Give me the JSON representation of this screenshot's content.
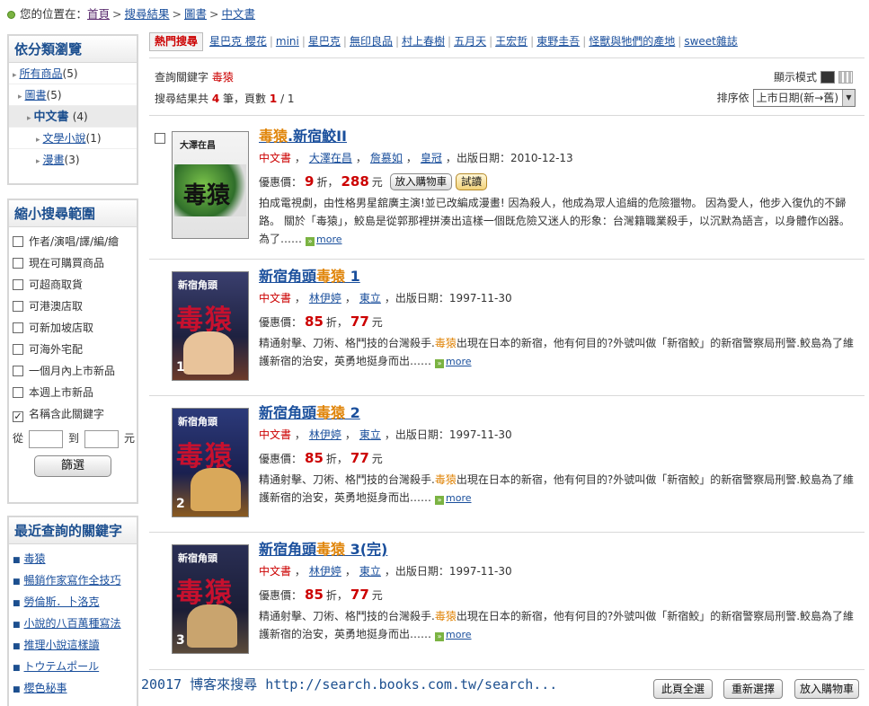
{
  "breadcrumb": {
    "label": "您的位置在：",
    "items": [
      "首頁",
      "搜尋結果",
      "圖書",
      "中文書"
    ],
    "sep": ">"
  },
  "sidebar": {
    "browse": {
      "title": "依分類瀏覽",
      "items": [
        {
          "label": "所有商品",
          "count": "(5)"
        },
        {
          "label": "圖書",
          "count": "(5)"
        },
        {
          "label": "中文書",
          "count": "(4)"
        },
        {
          "label": "文學小說",
          "count": "(1)"
        },
        {
          "label": "漫畫",
          "count": "(3)"
        }
      ]
    },
    "filter": {
      "title": "縮小搜尋範圍",
      "options": [
        "作者/演唱/譯/編/繪",
        "現在可購買商品",
        "可超商取貨",
        "可港澳店取",
        "可新加坡店取",
        "可海外宅配",
        "一個月內上市新品",
        "本週上市新品",
        "名稱含此關鍵字"
      ],
      "checked_mark": "✓",
      "price_from": "從",
      "price_to": "到",
      "price_unit": "元",
      "button": "篩選"
    },
    "recent": {
      "title": "最近查詢的關鍵字",
      "items": [
        "毒猿",
        "暢銷作家寫作全技巧",
        "勞倫斯．卜洛克",
        "小說的八百萬種寫法",
        "推理小說這樣讀",
        "トウテムポール",
        "櫻色秘事"
      ]
    }
  },
  "hot": {
    "tag": "熱門搜尋",
    "items": [
      "星巴克 櫻花",
      "mini",
      "星巴克",
      "無印良品",
      "村上春樹",
      "五月天",
      "王宏哲",
      "東野圭吾",
      "怪獸與牠們的產地",
      "sweet雜誌"
    ]
  },
  "search": {
    "keyword_label": "查詢關鍵字",
    "keyword": "毒猿",
    "summary_pre": "搜尋結果共",
    "total": "4",
    "summary_mid": "筆，頁數",
    "page": "1",
    "pages": "/ 1",
    "display_mode_label": "顯示模式",
    "sort_label": "排序依",
    "sort_value": "上市日期(新→舊)"
  },
  "results": [
    {
      "title_pre": "",
      "title_hl": "毒猿",
      "title_post": ".新宿鮫II",
      "cat": "中文書",
      "people": [
        "大澤在昌",
        "詹慕如",
        "皇冠"
      ],
      "date_label": "出版日期：",
      "date": "2010-12-13",
      "price_label": "優惠價：",
      "discount": "9",
      "discount_unit": "折，",
      "price": "288",
      "price_unit": "元",
      "cart": "放入購物車",
      "try": "試讀",
      "desc": "拍成電視劇，由性格男星舘廣主演!並已改編成漫畫! 因為殺人，他成為眾人追緝的危險獵物。 因為愛人，他步入復仇的不歸路。 關於「毒猿」，鮫島是從郭那裡拼湊出這樣一個既危險又迷人的形象：台灣籍職業殺手，以沉默為語言，以身體作凶器。為了……",
      "more": "more"
    },
    {
      "title_pre": "新宿角頭",
      "title_hl": "毒猿",
      "title_post": " 1",
      "cat": "中文書",
      "people": [
        "林伊婷",
        "東立"
      ],
      "date_label": "出版日期：",
      "date": "1997-11-30",
      "price_label": "優惠價：",
      "discount": "85",
      "discount_unit": "折，",
      "price": "77",
      "price_unit": "元",
      "desc_pre": "精通射擊、刀術、格鬥技的台灣殺手.",
      "desc_hl": "毒猿",
      "desc_post": "出現在日本的新宿，他有何目的?外號叫做「新宿鮫」的新宿警察局刑警.鮫島為了維護新宿的治安，英勇地挺身而出……",
      "more": "more"
    },
    {
      "title_pre": "新宿角頭",
      "title_hl": "毒猿",
      "title_post": " 2",
      "cat": "中文書",
      "people": [
        "林伊婷",
        "東立"
      ],
      "date_label": "出版日期：",
      "date": "1997-11-30",
      "price_label": "優惠價：",
      "discount": "85",
      "discount_unit": "折，",
      "price": "77",
      "price_unit": "元",
      "desc_pre": "精通射擊、刀術、格鬥技的台灣殺手.",
      "desc_hl": "毒猿",
      "desc_post": "出現在日本的新宿，他有何目的?外號叫做「新宿鮫」的新宿警察局刑警.鮫島為了維護新宿的治安，英勇地挺身而出……",
      "more": "more"
    },
    {
      "title_pre": "新宿角頭",
      "title_hl": "毒猿",
      "title_post": " 3(完)",
      "cat": "中文書",
      "people": [
        "林伊婷",
        "東立"
      ],
      "date_label": "出版日期：",
      "date": "1997-11-30",
      "price_label": "優惠價：",
      "discount": "85",
      "discount_unit": "折，",
      "price": "77",
      "price_unit": "元",
      "desc_pre": "精通射擊、刀術、格鬥技的台灣殺手.",
      "desc_hl": "毒猿",
      "desc_post": "出現在日本的新宿，他有何目的?外號叫做「新宿鮫」的新宿警察局刑警.鮫島為了維護新宿的治安，英勇地挺身而出……",
      "more": "more"
    }
  ],
  "covers": [
    {
      "top": "大澤在昌",
      "big": "毒猿",
      "vol": ""
    },
    {
      "top": "新宿角頭",
      "big": "毒猿",
      "vol": "1"
    },
    {
      "top": "新宿角頭",
      "big": "毒猿",
      "vol": "2"
    },
    {
      "top": "新宿角頭",
      "big": "毒猿",
      "vol": "3"
    }
  ],
  "footer": {
    "url_text": "20017 博客來搜尋 http://search.books.com.tw/search...",
    "select_all": "此頁全選",
    "reselect": "重新選擇",
    "add_cart": "放入購物車"
  },
  "colors": {
    "accent": "#1c4f8f",
    "highlight": "#e0850a",
    "price": "#cc0000"
  }
}
